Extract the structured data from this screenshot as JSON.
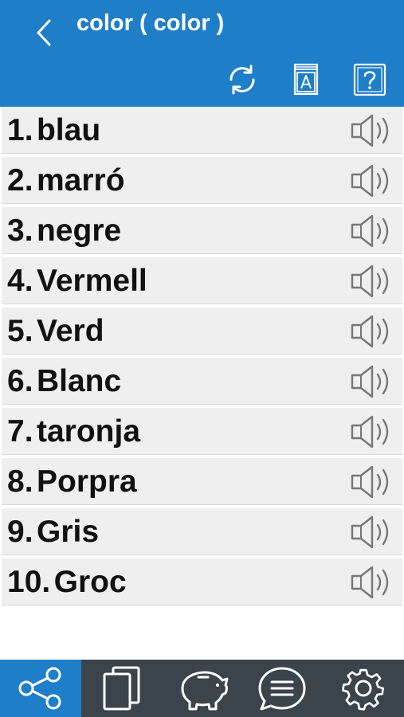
{
  "header": {
    "title": "color ( color )"
  },
  "words": [
    {
      "num": "1.",
      "word": "blau"
    },
    {
      "num": "2.",
      "word": "marró"
    },
    {
      "num": "3.",
      "word": "negre"
    },
    {
      "num": "4.",
      "word": "Vermell"
    },
    {
      "num": "5.",
      "word": "Verd"
    },
    {
      "num": "6.",
      "word": "Blanc"
    },
    {
      "num": "7.",
      "word": "taronja"
    },
    {
      "num": "8.",
      "word": "Porpra"
    },
    {
      "num": "9.",
      "word": "Gris"
    },
    {
      "num": "10.",
      "word": "Groc"
    }
  ],
  "toolbar": {
    "icons": [
      "refresh-icon",
      "dictionary-icon",
      "help-icon"
    ]
  },
  "bottom_nav": {
    "items": [
      "share-icon",
      "cards-icon",
      "piggy-bank-icon",
      "chat-icon",
      "settings-icon"
    ],
    "active": "share-icon"
  },
  "colors": {
    "header": "#1e7ec8",
    "row_background": "#efefef",
    "bottom_bar": "#3b434b",
    "active_tab": "#1e7ec8"
  }
}
